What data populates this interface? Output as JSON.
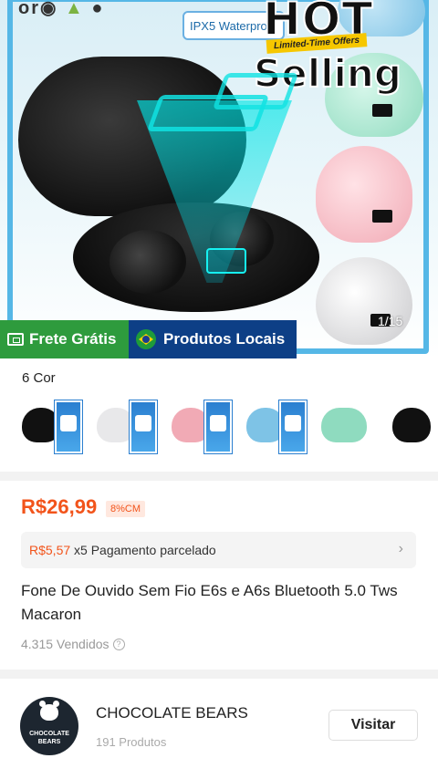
{
  "hero": {
    "os_text": "or",
    "ipx_text": "IPX5 Waterpro",
    "hot_text": "HOT",
    "offer_text": "Limited-Time Offers",
    "selling_text": "Selling",
    "image_counter": "1/15",
    "badges": {
      "frete": "Frete Grátis",
      "produtos": "Produtos Locais"
    }
  },
  "colors": {
    "label": "6 Cor",
    "options": [
      {
        "color": "#111111"
      },
      {
        "color": "#e8e8ea"
      },
      {
        "color": "#f1aab5"
      },
      {
        "color": "#7ec3e6"
      },
      {
        "color": "#8fdbbf"
      },
      {
        "color": "#111111"
      }
    ]
  },
  "product": {
    "price": "R$26,99",
    "price_tag": "8%CM",
    "installment_amount": "R$5,57",
    "installment_text": " x5 Pagamento parcelado",
    "title": "Fone De Ouvido Sem Fio E6s e A6s Bluetooth 5.0 Tws Macaron",
    "sold": "4.315 Vendidos"
  },
  "store": {
    "logo_text": "CHOCOLATE BEARS",
    "name": "CHOCOLATE BEARS",
    "count": "191 Produtos",
    "visit_label": "Visitar"
  },
  "accent_color": "#f2541b"
}
